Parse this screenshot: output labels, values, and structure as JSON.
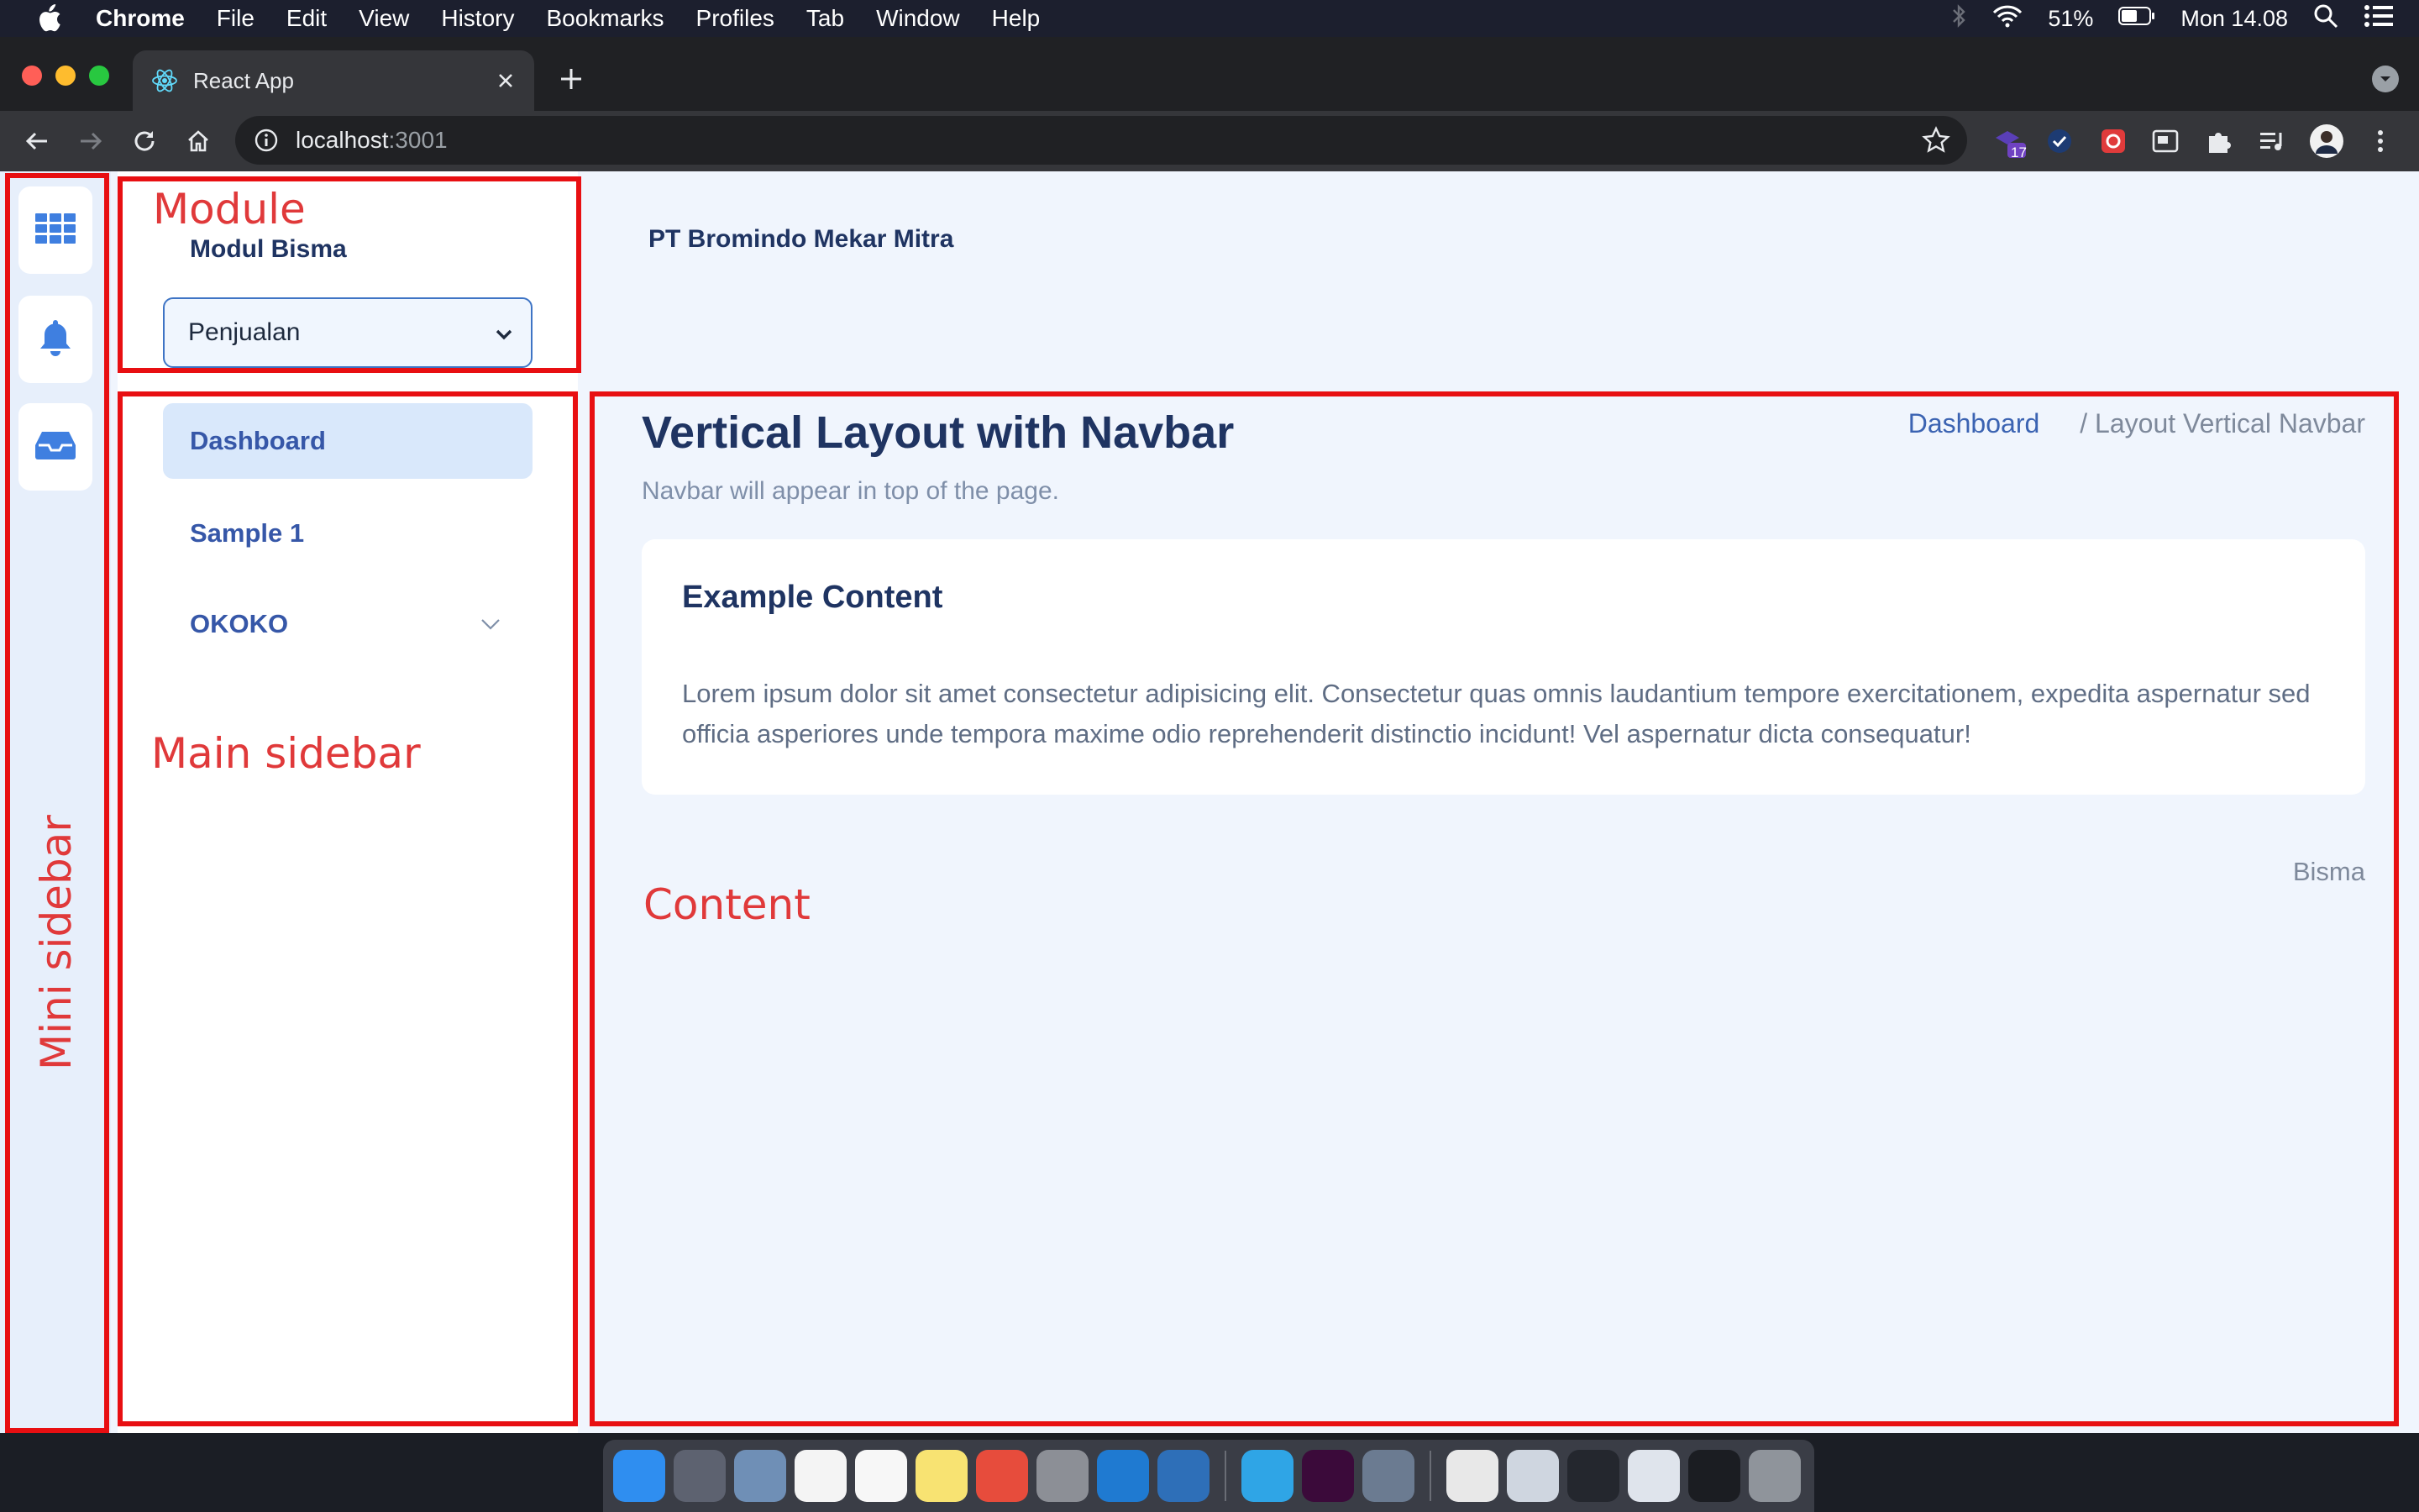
{
  "menubar": {
    "app_name": "Chrome",
    "items": [
      "File",
      "Edit",
      "View",
      "History",
      "Bookmarks",
      "Profiles",
      "Tab",
      "Window",
      "Help"
    ],
    "battery": "51%",
    "clock": "Mon 14.08"
  },
  "browser": {
    "tab_title": "React App",
    "url_host": "localhost",
    "url_port": ":3001",
    "extension_badge": "17"
  },
  "mini_sidebar": {
    "items": [
      "grid-icon",
      "bell-icon",
      "inbox-icon"
    ]
  },
  "main_sidebar": {
    "module_title": "Modul Bisma",
    "module_select_value": "Penjualan",
    "nav": [
      {
        "label": "Dashboard",
        "active": true
      },
      {
        "label": "Sample 1",
        "active": false
      },
      {
        "label": "OKOKO",
        "active": false,
        "has_children": true
      }
    ]
  },
  "topbar": {
    "company": "PT Bromindo Mekar Mitra"
  },
  "content": {
    "title": "Vertical Layout with Navbar",
    "subtitle": "Navbar will appear in top of the page.",
    "breadcrumb": [
      "Dashboard",
      "/  Layout Vertical Navbar"
    ],
    "card_title": "Example Content",
    "card_body": "Lorem ipsum dolor sit amet consectetur adipisicing elit. Consectetur quas omnis laudantium tempore exercitationem, expedita aspernatur sed officia asperiores unde tempora maxime odio reprehenderit distinctio incidunt! Vel aspernatur dicta consequatur!",
    "footer": "Bisma"
  },
  "annotations": {
    "module": "Module",
    "main_sidebar": "Main sidebar",
    "content": "Content",
    "mini_sidebar": "Mini sidebar"
  },
  "colors": {
    "accent": "#3e74c5",
    "annotation": "#e80f12",
    "heading": "#1f3462"
  }
}
